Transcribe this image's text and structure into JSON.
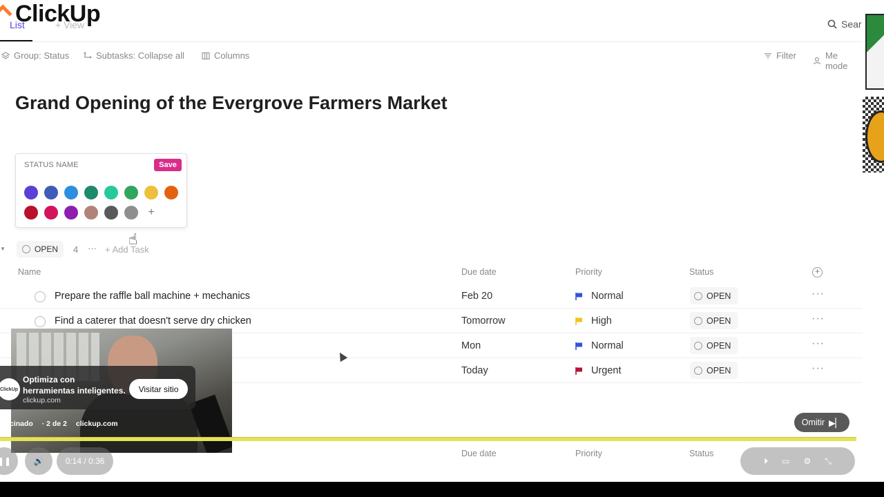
{
  "app": {
    "logo": "ClickUp"
  },
  "tabs": {
    "list": "List",
    "view": "+ View"
  },
  "search": {
    "label": "Sear"
  },
  "toolbar": {
    "group": "Group: Status",
    "subtasks": "Subtasks: Collapse all",
    "columns": "Columns",
    "filter": "Filter",
    "me_mode": "Me mode"
  },
  "page": {
    "title": "Grand Opening of the Evergrove Farmers Market"
  },
  "status_popover": {
    "placeholder": "STATUS NAME",
    "save": "Save",
    "colors": [
      "#5b3fd6",
      "#3f5cb8",
      "#2d8fe0",
      "#1d8a6a",
      "#27c99a",
      "#31a65e",
      "#eebf3a",
      "#e3620f",
      "#b9102c",
      "#d2145a",
      "#8c1eb0",
      "#b0847a",
      "#5a5a5a",
      "#8f8f8f"
    ],
    "add_symbol": "+"
  },
  "group": {
    "status": "OPEN",
    "count": "4",
    "more": "···",
    "add_task": "+ Add Task"
  },
  "columns": {
    "name": "Name",
    "due": "Due date",
    "priority": "Priority",
    "status": "Status"
  },
  "tasks": [
    {
      "name": "Prepare the raffle ball machine + mechanics",
      "due": "Feb 20",
      "priority": "Normal",
      "flag_color": "#2e55d8",
      "status": "OPEN"
    },
    {
      "name": "Find a caterer that doesn't serve dry chicken",
      "due": "Tomorrow",
      "priority": "High",
      "flag_color": "#f2c319",
      "status": "OPEN"
    },
    {
      "name": "",
      "due": "Mon",
      "priority": "Normal",
      "flag_color": "#2e55d8",
      "status": "OPEN"
    },
    {
      "name": "",
      "due": "Today",
      "priority": "Urgent",
      "flag_color": "#b4123a",
      "status": "OPEN"
    }
  ],
  "ad": {
    "logo_text": "ClickUp",
    "headline": "Optimiza con herramientas inteligentes.",
    "domain": "clickup.com",
    "visit": "Visitar sitio",
    "sponsored": "trocinado",
    "counter": "· 2 de 2",
    "site": "clickup.com",
    "skip": "Omitir"
  },
  "player": {
    "time": "0:14 / 0:36"
  },
  "bottom_columns": {
    "due": "Due date",
    "priority": "Priority",
    "status": "Status"
  }
}
